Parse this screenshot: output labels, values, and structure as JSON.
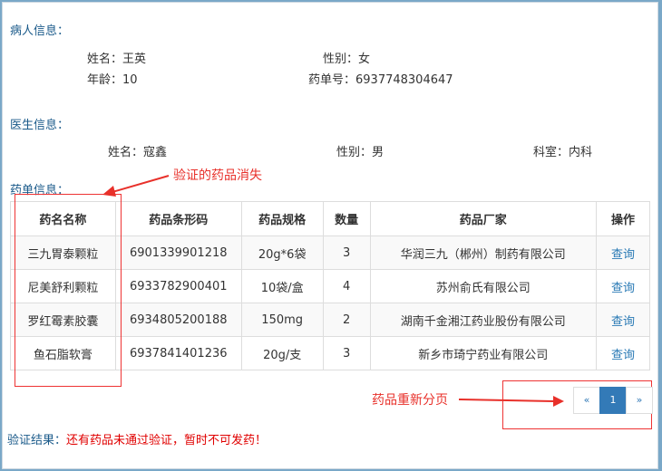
{
  "patient": {
    "section_title": "病人信息：",
    "name": "姓名：王英",
    "gender": "性别：女",
    "age": "年龄：10",
    "order_no": "药单号：6937748304647"
  },
  "doctor": {
    "section_title": "医生信息：",
    "name": "姓名：寇鑫",
    "gender": "性别：男",
    "dept": "科室：内科"
  },
  "order": {
    "section_title": "药单信息：",
    "headers": [
      "药名名称",
      "药品条形码",
      "药品规格",
      "数量",
      "药品厂家",
      "操作"
    ],
    "rows": [
      [
        "三九胃泰颗粒",
        "6901339901218",
        "20g*6袋",
        "3",
        "华润三九（郴州）制药有限公司",
        "查询"
      ],
      [
        "尼美舒利颗粒",
        "6933782900401",
        "10袋/盒",
        "4",
        "苏州俞氏有限公司",
        "查询"
      ],
      [
        "罗红霉素胶囊",
        "6934805200188",
        "150mg",
        "2",
        "湖南千金湘江药业股份有限公司",
        "查询"
      ],
      [
        "鱼石脂软膏",
        "6937841401236",
        "20g/支",
        "3",
        "新乡市琦宁药业有限公司",
        "查询"
      ]
    ]
  },
  "pagination": {
    "prev": "«",
    "current": "1",
    "next": "»"
  },
  "annotations": {
    "drug_disappear": "验证的药品消失",
    "repaginate": "药品重新分页",
    "color": "#e8302a"
  },
  "result": {
    "label": "验证结果：",
    "message": "还有药品未通过验证，暂时不可发药！"
  }
}
